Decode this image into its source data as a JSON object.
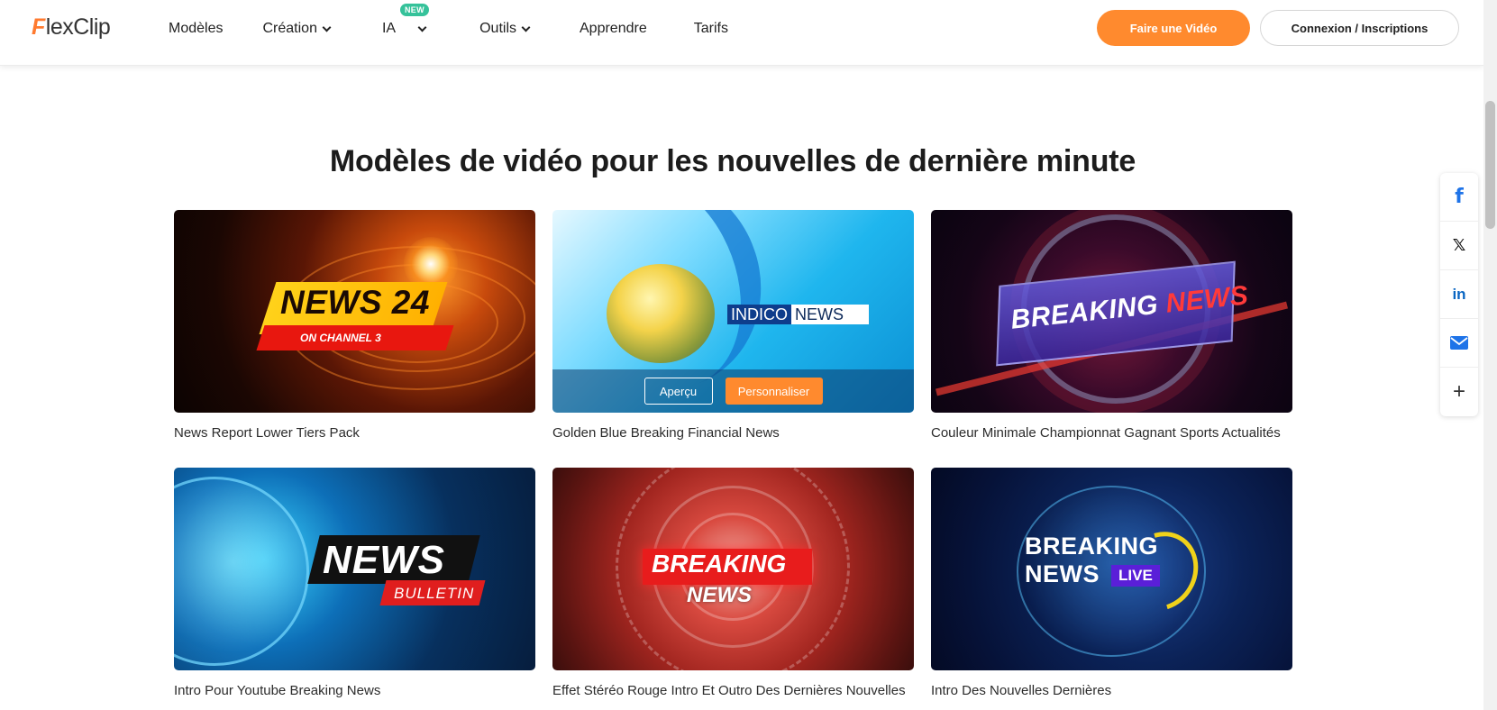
{
  "header": {
    "logo_first": "F",
    "logo_rest": "lexClip",
    "nav": [
      {
        "label": "Modèles",
        "has_dropdown": false
      },
      {
        "label": "Création",
        "has_dropdown": true
      },
      {
        "label": "IA",
        "has_dropdown": true,
        "badge": "NEW"
      },
      {
        "label": "Outils",
        "has_dropdown": true
      },
      {
        "label": "Apprendre",
        "has_dropdown": false
      },
      {
        "label": "Tarifs",
        "has_dropdown": false
      }
    ],
    "cta_primary": "Faire une Vidéo",
    "cta_secondary": "Connexion / Inscriptions"
  },
  "main": {
    "title": "Modèles de vidéo pour les nouvelles de dernière minute",
    "templates": [
      {
        "title": "News Report Lower Tiers Pack",
        "thumb_text_1": "NEWS 24",
        "thumb_text_2": "ON CHANNEL 3"
      },
      {
        "title": "Golden Blue Breaking Financial News",
        "thumb_text_1": "INDICO",
        "thumb_text_2": "NEWS",
        "preview_label": "Aperçu",
        "customize_label": "Personnaliser"
      },
      {
        "title": "Couleur Minimale Championnat Gagnant Sports Actualités",
        "thumb_text_1": "BREAKING",
        "thumb_text_2": "NEWS"
      },
      {
        "title": "Intro Pour Youtube Breaking News",
        "thumb_text_1": "NEWS",
        "thumb_text_2": "BULLETIN"
      },
      {
        "title": "Effet Stéréo Rouge Intro Et Outro Des Dernières Nouvelles",
        "thumb_text_1": "BREAKING",
        "thumb_text_2": "NEWS"
      },
      {
        "title": "Intro Des Nouvelles Dernières",
        "thumb_text_1": "BREAKING",
        "thumb_text_2": "NEWS",
        "thumb_text_3": "LIVE"
      }
    ]
  },
  "share": {
    "icons": [
      "facebook-icon",
      "x-icon",
      "linkedin-icon",
      "email-icon",
      "plus-icon"
    ],
    "facebook": "f",
    "x": "𝕏",
    "linkedin": "in",
    "plus": "+"
  },
  "colors": {
    "accent": "#ff8a2e",
    "badge": "#35c29a",
    "facebook": "#1e73e8",
    "linkedin": "#0a66c2"
  }
}
